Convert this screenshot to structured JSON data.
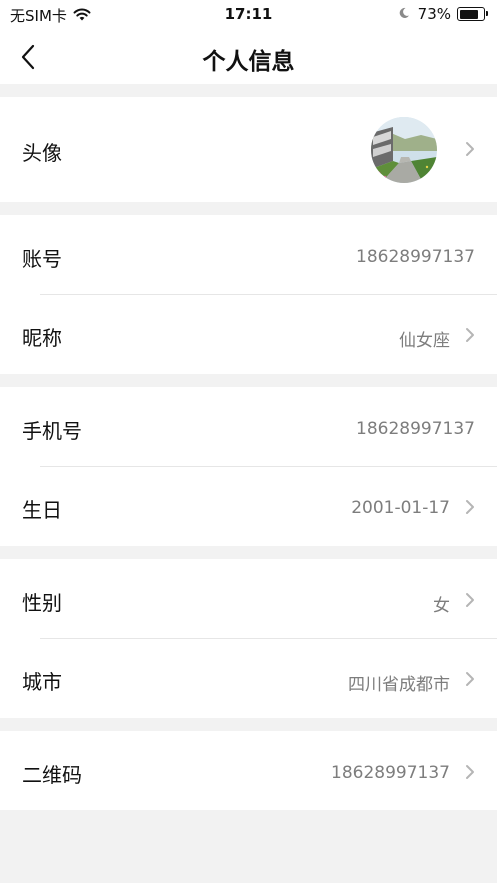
{
  "status_bar": {
    "carrier": "无SIM卡",
    "time": "17:11",
    "battery": "73%"
  },
  "nav": {
    "title": "个人信息"
  },
  "rows": {
    "avatar": {
      "label": "头像"
    },
    "account": {
      "label": "账号",
      "value": "18628997137"
    },
    "nickname": {
      "label": "昵称",
      "value": "仙女座"
    },
    "phone": {
      "label": "手机号",
      "value": "18628997137"
    },
    "birthday": {
      "label": "生日",
      "value": "2001-01-17"
    },
    "gender": {
      "label": "性别",
      "value": "女"
    },
    "city": {
      "label": "城市",
      "value": "四川省成都市"
    },
    "qrcode": {
      "label": "二维码",
      "value": "18628997137"
    }
  },
  "icons": {
    "back": "chevron-left-icon",
    "disclosure": "chevron-right-icon",
    "wifi": "wifi-icon",
    "moon": "moon-icon",
    "battery": "battery-icon"
  },
  "colors": {
    "background": "#f2f2f2",
    "card": "#ffffff",
    "value_text": "#7d7d7d",
    "chevron": "#b5b5b5",
    "divider": "#e6e6e6"
  }
}
